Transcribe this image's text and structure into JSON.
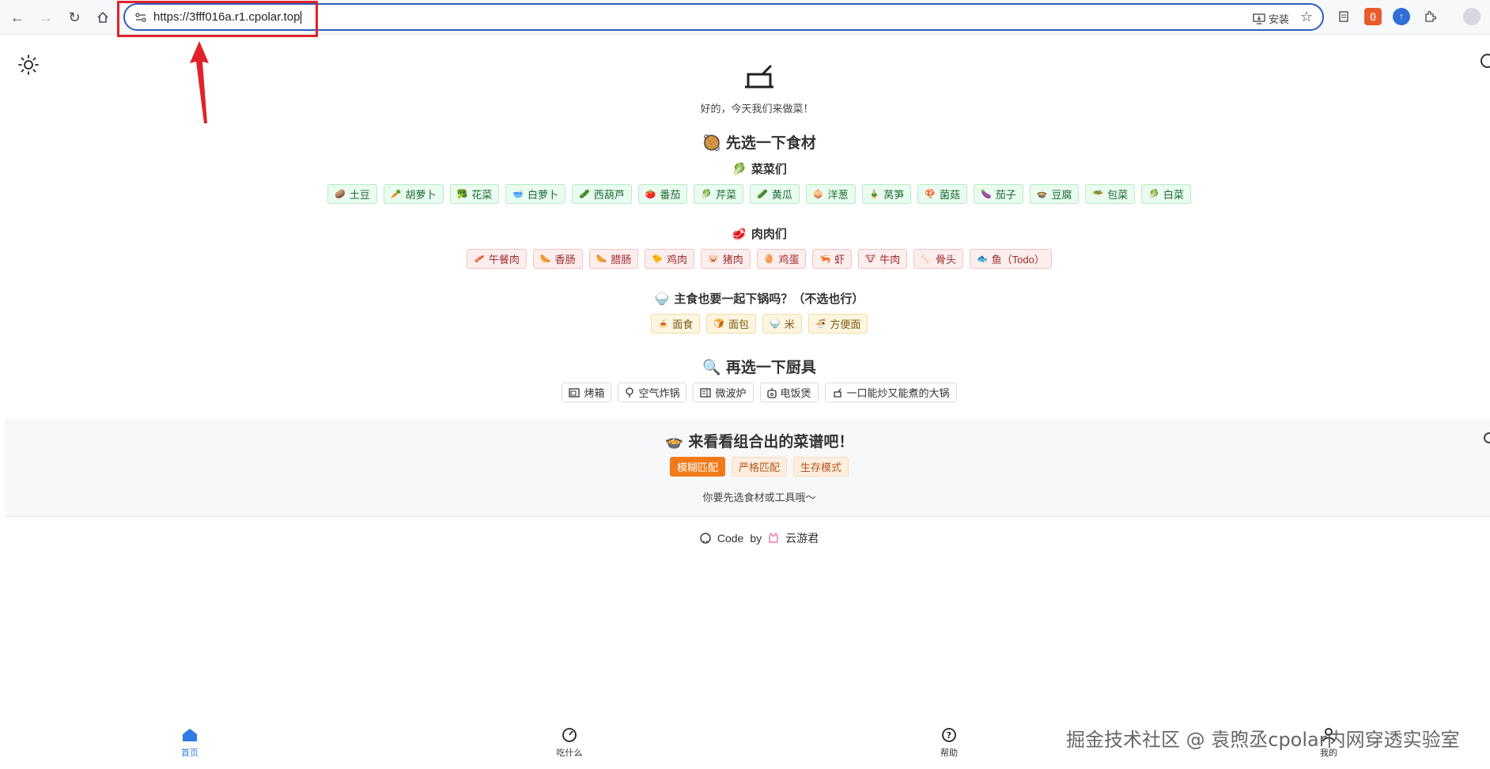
{
  "browser": {
    "url": "https://3fff016a.r1.cpolar.top",
    "install_label": "安装",
    "ext_red_label": "{}",
    "ext_blue_label": "↑"
  },
  "app": {
    "subtitle": "好的，今天我们来做菜！",
    "choose_ingredients_title": "先选一下食材",
    "choose_ingredients_emoji": "🥘",
    "veg_title": "菜菜们",
    "veg_emoji": "🥬",
    "meat_title": "肉肉们",
    "meat_emoji": "🥩",
    "staple_title": "主食也要一起下锅吗？（不选也行）",
    "staple_emoji": "🍚",
    "tools_title": "再选一下厨具",
    "tools_emoji": "🔍",
    "result_title": "来看看组合出的菜谱吧！",
    "result_emoji": "🍲",
    "hint": "你要先选食材或工具哦～",
    "footer_code": "Code",
    "footer_by": "by",
    "footer_author": "云游君"
  },
  "vegetables": [
    {
      "icon": "🥔",
      "label": "土豆"
    },
    {
      "icon": "🥕",
      "label": "胡萝卜"
    },
    {
      "icon": "🥦",
      "label": "花菜"
    },
    {
      "icon": "🥣",
      "label": "白萝卜"
    },
    {
      "icon": "🥒",
      "label": "西葫芦"
    },
    {
      "icon": "🍅",
      "label": "番茄"
    },
    {
      "icon": "🥬",
      "label": "芹菜"
    },
    {
      "icon": "🥒",
      "label": "黄瓜"
    },
    {
      "icon": "🧅",
      "label": "洋葱"
    },
    {
      "icon": "🎍",
      "label": "莴笋"
    },
    {
      "icon": "🍄",
      "label": "菌菇"
    },
    {
      "icon": "🍆",
      "label": "茄子"
    },
    {
      "icon": "🍲",
      "label": "豆腐"
    },
    {
      "icon": "🥗",
      "label": "包菜"
    },
    {
      "icon": "🥬",
      "label": "白菜"
    }
  ],
  "meats": [
    {
      "icon": "🥓",
      "label": "午餐肉"
    },
    {
      "icon": "🌭",
      "label": "香肠"
    },
    {
      "icon": "🌭",
      "label": "腊肠"
    },
    {
      "icon": "🐤",
      "label": "鸡肉"
    },
    {
      "icon": "🐷",
      "label": "猪肉"
    },
    {
      "icon": "🥚",
      "label": "鸡蛋"
    },
    {
      "icon": "🦐",
      "label": "虾"
    },
    {
      "icon": "🐮",
      "label": "牛肉"
    },
    {
      "icon": "🦴",
      "label": "骨头"
    },
    {
      "icon": "🐟",
      "label": "鱼（Todo）"
    }
  ],
  "staples": [
    {
      "icon": "🍝",
      "label": "面食"
    },
    {
      "icon": "🍞",
      "label": "面包"
    },
    {
      "icon": "🍚",
      "label": "米"
    },
    {
      "icon": "🍜",
      "label": "方便面"
    }
  ],
  "tools": [
    {
      "icon": "oven-icon",
      "label": "烤箱"
    },
    {
      "icon": "air-fryer-icon",
      "label": "空气炸锅"
    },
    {
      "icon": "microwave-icon",
      "label": "微波炉"
    },
    {
      "icon": "rice-cooker-icon",
      "label": "电饭煲"
    },
    {
      "icon": "pot-icon",
      "label": "一口能炒又能煮的大锅"
    }
  ],
  "modes": [
    {
      "label": "模糊匹配",
      "active": true
    },
    {
      "label": "严格匹配",
      "active": false
    },
    {
      "label": "生存模式",
      "active": false
    }
  ],
  "tabs": [
    {
      "icon": "home-icon",
      "label": "首页",
      "active": true
    },
    {
      "icon": "compass-icon",
      "label": "吃什么",
      "active": false
    },
    {
      "icon": "help-icon",
      "label": "帮助",
      "active": false
    },
    {
      "icon": "user-icon",
      "label": "我的",
      "active": false
    }
  ],
  "watermark": "掘金技术社区 @ 袁煦丞cpolar内网穿透实验室",
  "colors": {
    "accent": "#f27a1a",
    "tab_active": "#2f7ae5",
    "annotation_red": "#e0232a"
  }
}
